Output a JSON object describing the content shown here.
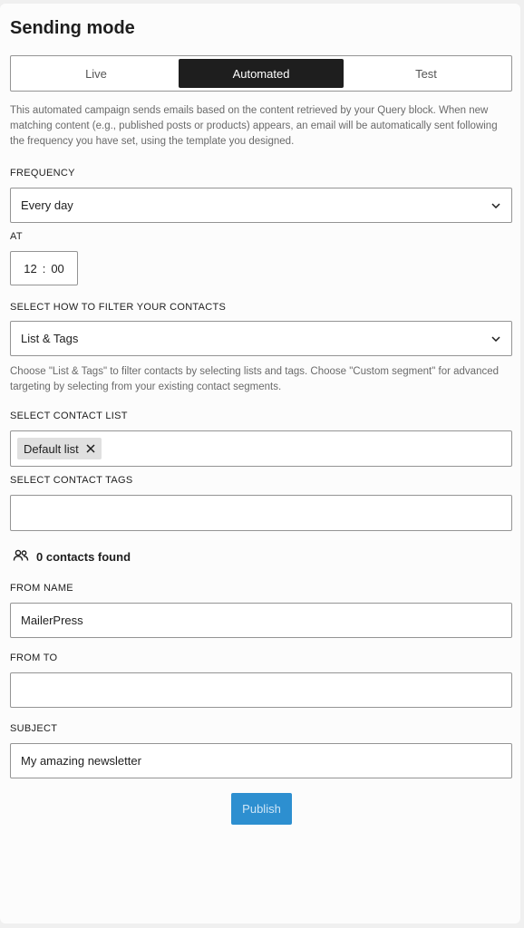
{
  "header": {
    "title": "Sending mode"
  },
  "mode_tabs": [
    {
      "label": "Live",
      "active": false
    },
    {
      "label": "Automated",
      "active": true
    },
    {
      "label": "Test",
      "active": false
    }
  ],
  "description": "This automated campaign sends emails based on the content retrieved by your Query block. When new matching content (e.g., published posts or products) appears, an email will be automatically sent following the frequency you have set, using the template you designed.",
  "frequency": {
    "label": "FREQUENCY",
    "value": "Every day"
  },
  "at": {
    "label": "AT",
    "hour": "12",
    "separator": ":",
    "minute": "00"
  },
  "filter": {
    "label": "SELECT HOW TO FILTER YOUR CONTACTS",
    "value": "List & Tags",
    "help": "Choose \"List & Tags\" to filter contacts by selecting lists and tags. Choose \"Custom segment\" for advanced targeting by selecting from your existing contact segments."
  },
  "contact_list": {
    "label": "SELECT CONTACT LIST",
    "chips": [
      "Default list"
    ]
  },
  "contact_tags": {
    "label": "SELECT CONTACT TAGS",
    "value": ""
  },
  "contacts_found": "0 contacts found",
  "from_name": {
    "label": "FROM NAME",
    "value": "MailerPress"
  },
  "from_to": {
    "label": "FROM TO",
    "value": ""
  },
  "subject": {
    "label": "SUBJECT",
    "value": "My amazing newsletter"
  },
  "actions": {
    "publish_label": "Publish"
  },
  "colors": {
    "accent": "#2d8fd0",
    "active_tab": "#1e1e1e"
  },
  "icons": {
    "dropdown": "chevron-down-icon",
    "remove_chip": "close-icon",
    "contacts": "users-icon"
  }
}
